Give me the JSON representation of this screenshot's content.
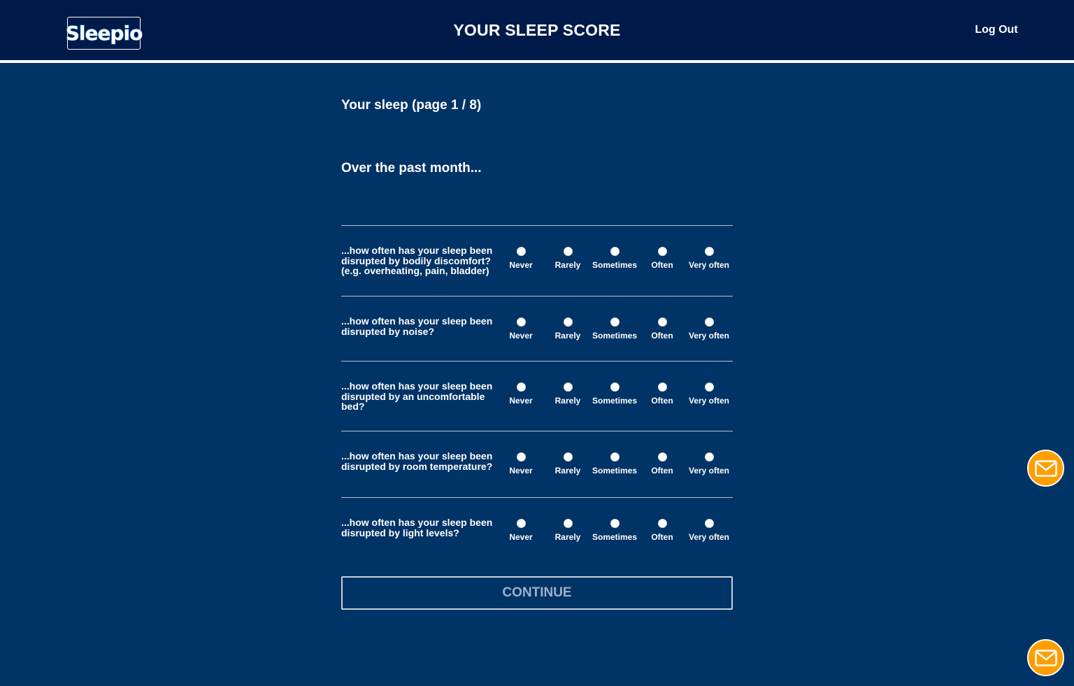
{
  "header": {
    "logo_text": "Sleepio",
    "title": "YOUR SLEEP SCORE",
    "logout_label": "Log Out"
  },
  "page": {
    "indicator": "Your sleep (page 1 / 8)",
    "intro": "Over the past month..."
  },
  "questions": [
    {
      "text": "...how often has your sleep been disrupted by bodily discomfort? (e.g. overheating, pain, bladder)"
    },
    {
      "text": "...how often has your sleep been disrupted by noise?"
    },
    {
      "text": "...how often has your sleep been disrupted by an uncomfortable bed?"
    },
    {
      "text": "...how often has your sleep been disrupted by room temperature?"
    },
    {
      "text": "...how often has your sleep been disrupted by light levels?"
    }
  ],
  "options": [
    "Never",
    "Rarely",
    "Sometimes",
    "Often",
    "Very often"
  ],
  "continue_label": "CONTINUE",
  "icons": {
    "logo": "sleepio-logo",
    "contact": "envelope-icon"
  },
  "colors": {
    "background": "#003366",
    "header": "#001a4a",
    "accent": "#ff9e00"
  }
}
